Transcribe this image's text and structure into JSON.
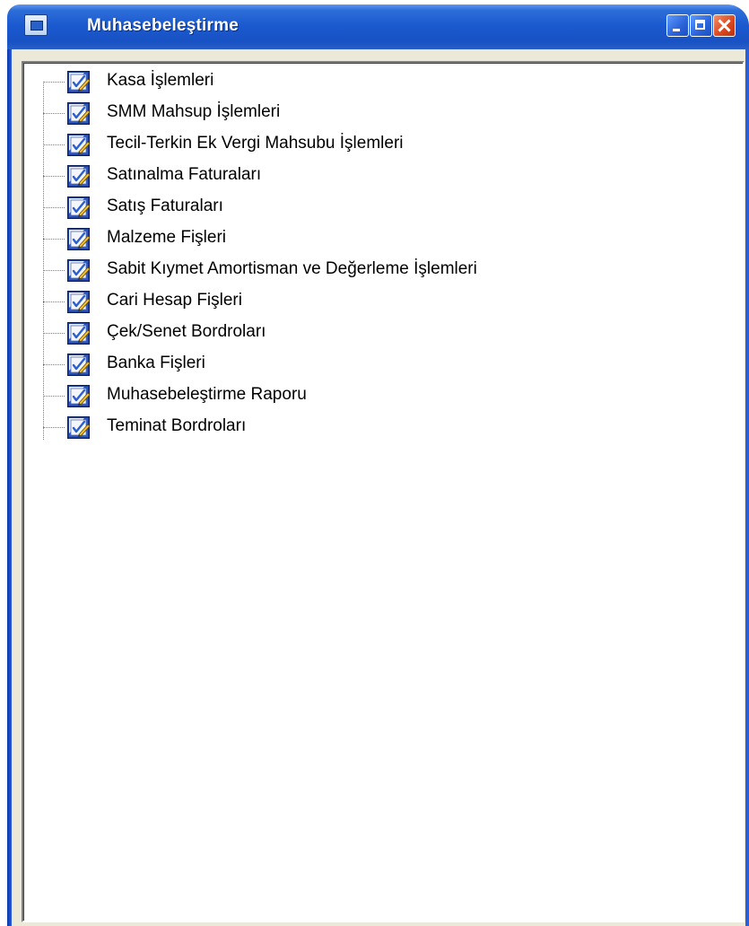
{
  "window": {
    "title": "Muhasebeleştirme"
  },
  "tree": {
    "items": [
      {
        "label": "Kasa İşlemleri"
      },
      {
        "label": "SMM Mahsup İşlemleri"
      },
      {
        "label": "Tecil-Terkin Ek Vergi Mahsubu İşlemleri"
      },
      {
        "label": "Satınalma Faturaları"
      },
      {
        "label": "Satış Faturaları"
      },
      {
        "label": "Malzeme Fişleri"
      },
      {
        "label": "Sabit Kıymet Amortisman ve Değerleme İşlemleri"
      },
      {
        "label": "Cari Hesap Fişleri"
      },
      {
        "label": "Çek/Senet Bordroları"
      },
      {
        "label": "Banka Fişleri"
      },
      {
        "label": "Muhasebeleştirme Raporu"
      },
      {
        "label": "Teminat Bordroları"
      }
    ],
    "item_icon": "edit-document-icon"
  },
  "colors": {
    "titlebar": "#1a59cf",
    "close_button": "#dc4a22",
    "panel_background": "#ffffff",
    "window_face": "#ece9d8"
  }
}
